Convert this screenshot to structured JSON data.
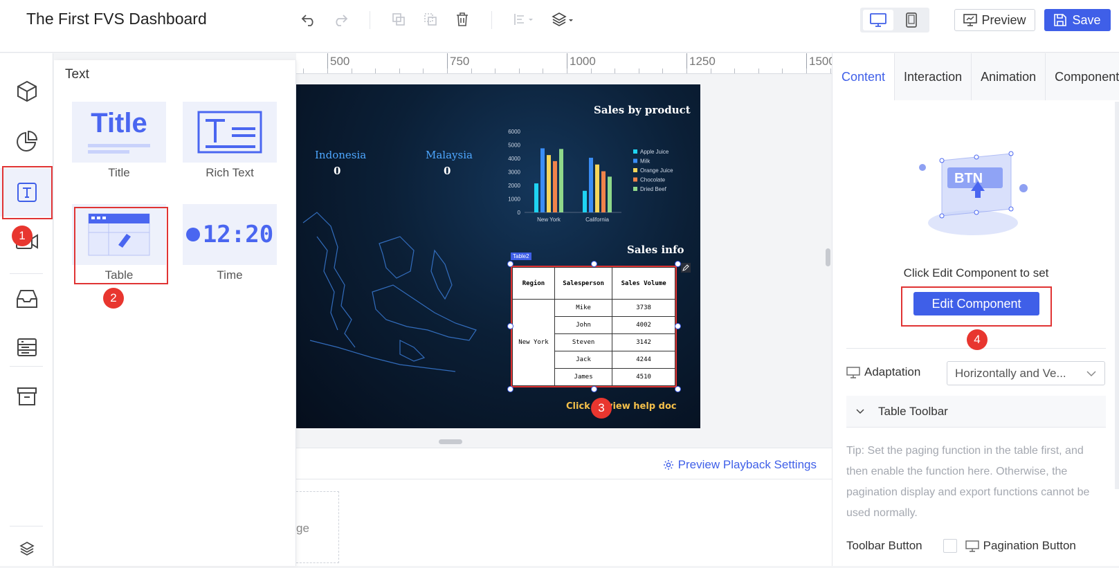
{
  "app": {
    "title": "The First FVS Dashboard"
  },
  "toolbar": {
    "undo_icon": "undo-icon",
    "redo_icon": "redo-icon",
    "preview_label": "Preview",
    "save_label": "Save"
  },
  "rail": {
    "items": [
      "3d-box-icon",
      "pie-chart-icon",
      "text-icon",
      "media-icon",
      "inbox-icon",
      "list-icon",
      "archive-icon",
      "layers-icon"
    ]
  },
  "drawer": {
    "title": "Text",
    "cards": [
      {
        "label": "Title",
        "thumb_text": "Title"
      },
      {
        "label": "Rich Text"
      },
      {
        "label": "Table"
      },
      {
        "label": "Time",
        "thumb_text": "12:20"
      }
    ]
  },
  "ruler": {
    "labels": [
      "500",
      "750",
      "1000",
      "1250",
      "1500"
    ]
  },
  "dashboard": {
    "kpis": [
      {
        "name": "Indonesia",
        "value": "0"
      },
      {
        "name": "Malaysia",
        "value": "0"
      }
    ],
    "sales_by_product_title": "Sales by product",
    "sales_info_title": "Sales info",
    "table_tag": "Table2",
    "table": {
      "headers": [
        "Region",
        "Salesperson",
        "Sales Volume"
      ],
      "region": "New York",
      "rows": [
        {
          "name": "Mike",
          "volume": "3738"
        },
        {
          "name": "John",
          "volume": "4002"
        },
        {
          "name": "Steven",
          "volume": "3142"
        },
        {
          "name": "Jack",
          "volume": "4244"
        },
        {
          "name": "James",
          "volume": "4510"
        }
      ]
    },
    "help_link": "Click to view help doc"
  },
  "chart_data": {
    "type": "bar",
    "title": "Sales by product",
    "categories": [
      "New York",
      "California"
    ],
    "yticks": [
      "6000",
      "5000",
      "4000",
      "3000",
      "2000",
      "1000",
      "0"
    ],
    "ylim": [
      0,
      6000
    ],
    "legend_position": "right",
    "series": [
      {
        "name": "Apple Juice",
        "color": "#1fd3f2",
        "values": [
          2150,
          1600
        ]
      },
      {
        "name": "Milk",
        "color": "#3a8df5",
        "values": [
          4750,
          4050
        ]
      },
      {
        "name": "Orange Juice",
        "color": "#f5d55a",
        "values": [
          4250,
          3550
        ]
      },
      {
        "name": "Chocolate",
        "color": "#f0834a",
        "values": [
          3800,
          3050
        ]
      },
      {
        "name": "Dried Beef",
        "color": "#8fd88a",
        "values": [
          4700,
          2650
        ]
      }
    ]
  },
  "bottom": {
    "playback_label": "Preview Playback Settings",
    "page_fragment": "ge"
  },
  "right_panel": {
    "tabs": [
      "Content",
      "Interaction",
      "Animation",
      "Component"
    ],
    "illus_text": "BTN",
    "hint": "Click Edit Component to set",
    "edit_button": "Edit Component",
    "adaptation_label": "Adaptation",
    "adaptation_value": "Horizontally and Ve...",
    "toolbar_section": "Table Toolbar",
    "tip": "Tip: Set the paging function in the table first, and then enable the function here. Otherwise, the pagination display and export functions cannot be used normally.",
    "toolbar_button_label": "Toolbar Button",
    "pagination_label": "Pagination Button"
  },
  "steps": [
    "1",
    "2",
    "3",
    "4"
  ],
  "colors": {
    "accent": "#3f5fe8",
    "marker": "#e8362f"
  }
}
